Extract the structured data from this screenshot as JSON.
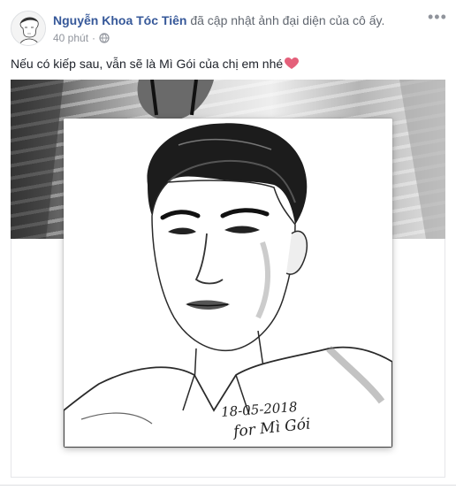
{
  "post": {
    "author": "Nguyễn Khoa Tóc Tiên",
    "action": "đã cập nhật ảnh đại diện của cô ấy.",
    "time": "40 phút",
    "privacy_icon": "globe-icon",
    "menu_icon": "more-options-icon",
    "caption": "Nếu có kiếp sau, vẫn sẽ là Mì Gói của chị em nhé",
    "caption_emoji": "heart-icon",
    "colors": {
      "author": "#365899",
      "meta": "#90949c",
      "heart": "#e4607a"
    }
  },
  "photo": {
    "signature_date": "18-05-2018",
    "signature_name": "for Mì Gói"
  }
}
